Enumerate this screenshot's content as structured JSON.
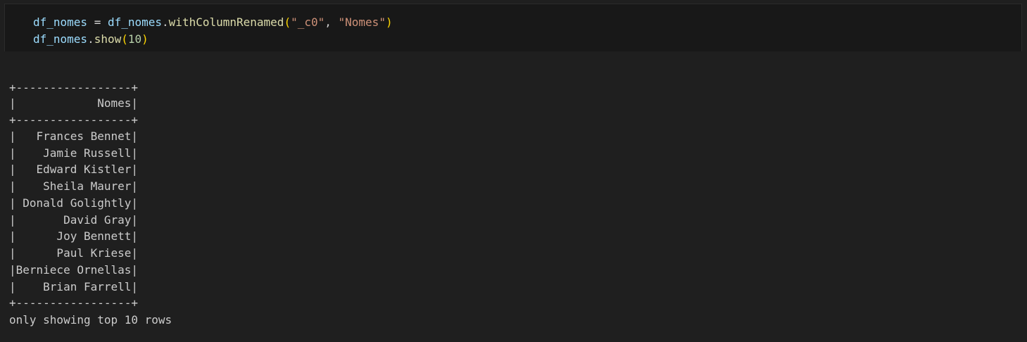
{
  "code_cell": {
    "line1": {
      "var": "df_nomes",
      "assign": " = ",
      "obj": "df_nomes",
      "dot": ".",
      "method": "withColumnRenamed",
      "open": "(",
      "arg1": "\"_c0\"",
      "comma": ", ",
      "arg2": "\"Nomes\"",
      "close": ")"
    },
    "line2": {
      "obj": "df_nomes",
      "dot": ".",
      "method": "show",
      "open": "(",
      "arg": "10",
      "close": ")"
    }
  },
  "output": {
    "border": "+-----------------+",
    "header": "|            Nomes|",
    "rows": [
      "|   Frances Bennet|",
      "|    Jamie Russell|",
      "|   Edward Kistler|",
      "|    Sheila Maurer|",
      "| Donald Golightly|",
      "|       David Gray|",
      "|      Joy Bennett|",
      "|      Paul Kriese|",
      "|Berniece Ornellas|",
      "|    Brian Farrell|"
    ],
    "footer": "only showing top 10 rows"
  }
}
